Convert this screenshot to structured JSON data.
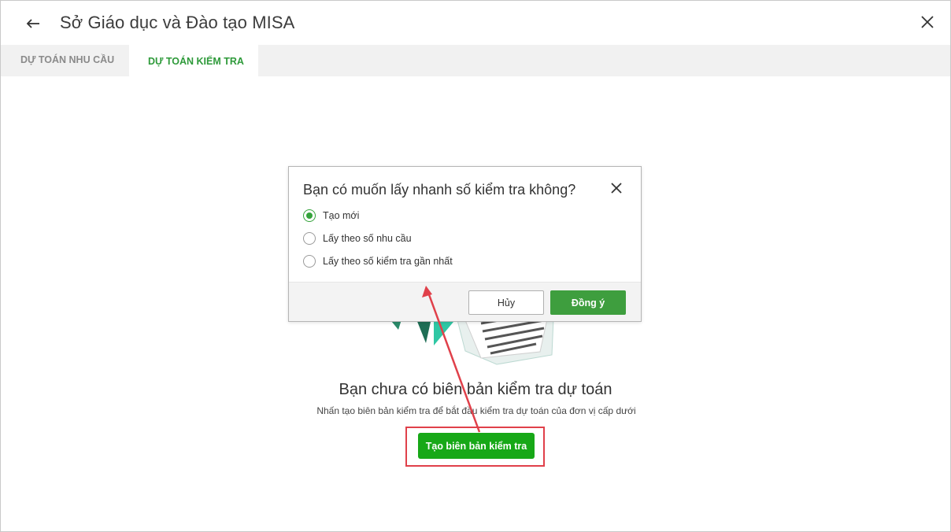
{
  "header": {
    "title": "Sở Giáo dục và Đào tạo MISA",
    "back_icon": "arrow-left-icon",
    "close_icon": "close-icon"
  },
  "tabs": [
    {
      "label": "Dự toán nhu cầu",
      "active": false
    },
    {
      "label": "Dự toán kiểm tra",
      "active": true
    }
  ],
  "empty_state": {
    "title": "Bạn chưa có biên bản kiểm tra dự toán",
    "subtitle": "Nhấn tạo biên bản kiểm tra để bắt đầu kiểm tra dự toán của đơn vị cấp dưới",
    "create_button": "Tạo biên bản kiểm tra"
  },
  "dialog": {
    "title": "Bạn có muốn lấy nhanh số kiểm tra không?",
    "options": [
      {
        "label": "Tạo mới",
        "selected": true
      },
      {
        "label": "Lấy theo số nhu cầu",
        "selected": false
      },
      {
        "label": "Lấy theo số kiểm tra gần nhất",
        "selected": false
      }
    ],
    "cancel_label": "Hủy",
    "ok_label": "Đồng ý"
  },
  "colors": {
    "accent_green": "#2e9a3a",
    "button_green": "#17a817",
    "annotation_red": "#e0404a"
  }
}
